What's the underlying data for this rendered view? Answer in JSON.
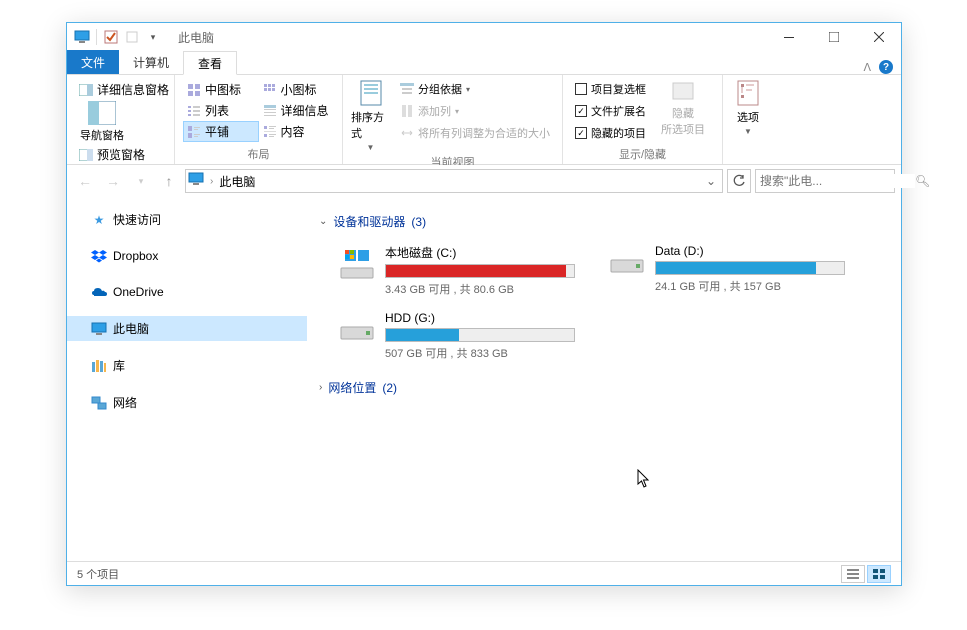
{
  "title": "此电脑",
  "tabs": {
    "file": "文件",
    "computer": "计算机",
    "view": "查看"
  },
  "ribbon": {
    "panes": {
      "nav": "导航窗格",
      "preview": "预览窗格",
      "details_pane": "详细信息窗格",
      "label": "窗格"
    },
    "layout": {
      "medium": "中图标",
      "small": "小图标",
      "list": "列表",
      "details": "详细信息",
      "tiles": "平铺",
      "content": "内容",
      "label": "布局"
    },
    "current": {
      "sort": "排序方式",
      "group": "分组依据",
      "addcol": "添加列",
      "autosize": "将所有列调整为合适的大小",
      "label": "当前视图"
    },
    "showhide": {
      "itemcheck": "项目复选框",
      "ext": "文件扩展名",
      "hidden": "隐藏的项目",
      "hide": "隐藏\n所选项目",
      "label": "显示/隐藏"
    },
    "options": "选项"
  },
  "addr": {
    "location": "此电脑"
  },
  "search": {
    "placeholder": "搜索\"此电..."
  },
  "tree": {
    "quick": "快速访问",
    "dropbox": "Dropbox",
    "onedrive": "OneDrive",
    "thispc": "此电脑",
    "libraries": "库",
    "network": "网络"
  },
  "groups": {
    "drives": {
      "label": "设备和驱动器",
      "count": "(3)"
    },
    "network": {
      "label": "网络位置",
      "count": "(2)"
    }
  },
  "drives": [
    {
      "name": "本地磁盘 (C:)",
      "free": "3.43 GB 可用 , 共 80.6 GB",
      "pct": 96,
      "color": "#da2626",
      "system": true
    },
    {
      "name": "Data (D:)",
      "free": "24.1 GB 可用 , 共 157 GB",
      "pct": 85,
      "color": "#26a0da",
      "system": false
    },
    {
      "name": "HDD (G:)",
      "free": "507 GB 可用 , 共 833 GB",
      "pct": 39,
      "color": "#26a0da",
      "system": false
    }
  ],
  "status": "5 个项目"
}
